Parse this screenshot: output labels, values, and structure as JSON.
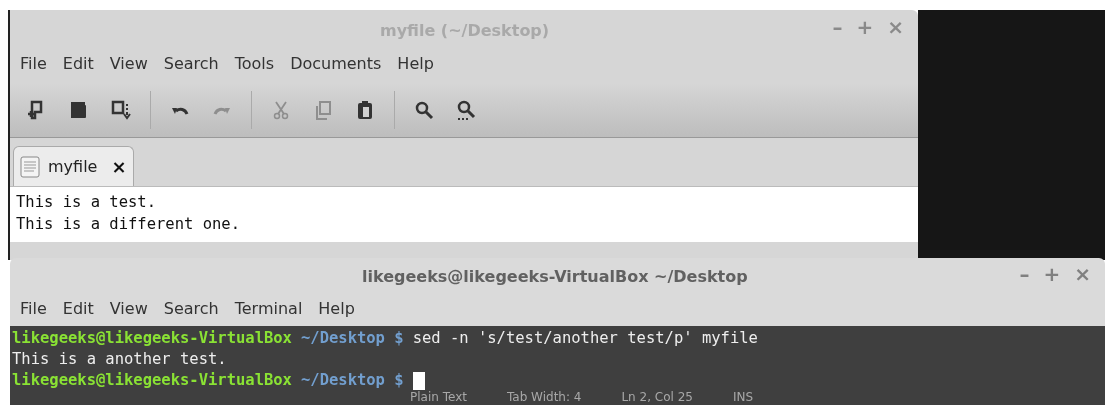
{
  "editor": {
    "title": "myfile (~/Desktop)",
    "window_buttons": [
      "–",
      "+",
      "×"
    ],
    "menu": [
      "File",
      "Edit",
      "View",
      "Search",
      "Tools",
      "Documents",
      "Help"
    ],
    "toolbar": [
      {
        "kind": "new",
        "disabled": false
      },
      {
        "kind": "open",
        "disabled": false
      },
      {
        "kind": "save",
        "disabled": false
      },
      {
        "kind": "sep"
      },
      {
        "kind": "undo",
        "disabled": false
      },
      {
        "kind": "redo",
        "disabled": true
      },
      {
        "kind": "sep"
      },
      {
        "kind": "cut",
        "disabled": true
      },
      {
        "kind": "copy",
        "disabled": true
      },
      {
        "kind": "paste",
        "disabled": false
      },
      {
        "kind": "sep"
      },
      {
        "kind": "find",
        "disabled": false
      },
      {
        "kind": "replace",
        "disabled": false
      }
    ],
    "tabs": [
      {
        "label": "myfile",
        "close": "×",
        "selected": true
      }
    ],
    "lines": [
      "This is a test.",
      "This is a different one."
    ],
    "status_bar": [
      "Plain Text",
      "Tab Width: 4",
      "Ln 2, Col 25",
      "INS"
    ]
  },
  "terminal": {
    "title": "likegeeks@likegeeks-VirtualBox ~/Desktop",
    "window_buttons": [
      "–",
      "+",
      "×"
    ],
    "menu": [
      "File",
      "Edit",
      "View",
      "Search",
      "Terminal",
      "Help"
    ],
    "lines": [
      {
        "kind": "prompt",
        "user": "likegeeks@likegeeks-VirtualBox",
        "path": "~/Desktop $",
        "command": "sed -n 's/test/another test/p' myfile",
        "cursor": false
      },
      {
        "kind": "output",
        "text": "This is a another test."
      },
      {
        "kind": "prompt",
        "user": "likegeeks@likegeeks-VirtualBox",
        "path": "~/Desktop $",
        "cursor": true
      }
    ]
  }
}
